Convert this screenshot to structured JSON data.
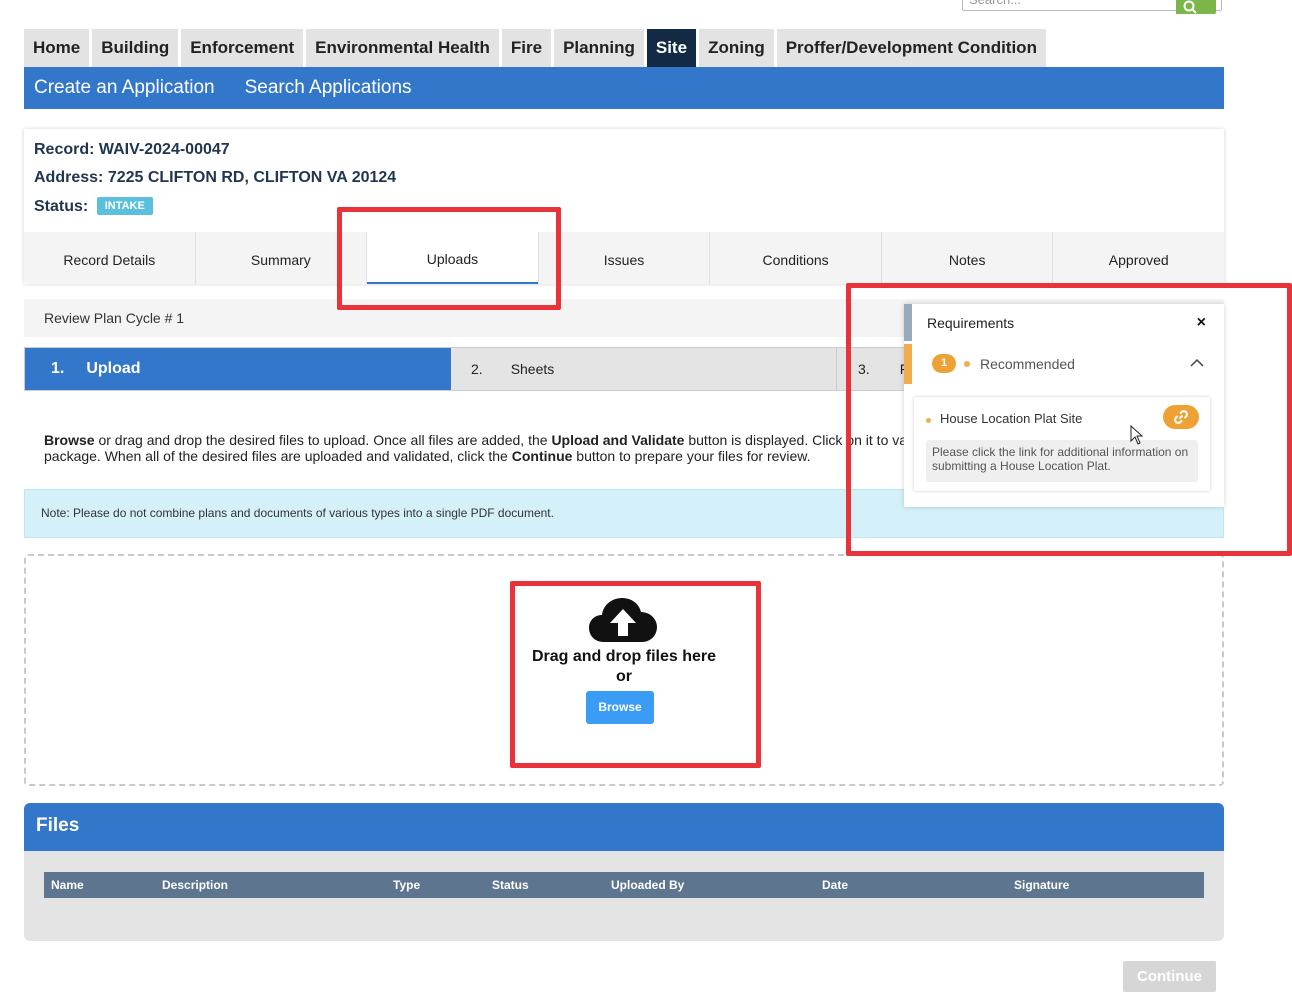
{
  "search": {
    "placeholder": "Search..."
  },
  "top_nav": {
    "tabs": [
      "Home",
      "Building",
      "Enforcement",
      "Environmental Health",
      "Fire",
      "Planning",
      "Site",
      "Zoning",
      "Proffer/Development Condition"
    ],
    "active": "Site"
  },
  "sub_nav": {
    "create": "Create an Application",
    "search": "Search Applications"
  },
  "record": {
    "record_label": "Record:",
    "record_id": "WAIV-2024-00047",
    "address_label": "Address:",
    "address": "7225 CLIFTON RD, CLIFTON VA 20124",
    "status_label": "Status:",
    "status": "INTAKE"
  },
  "record_tabs": [
    "Record Details",
    "Summary",
    "Uploads",
    "Issues",
    "Conditions",
    "Notes",
    "Approved"
  ],
  "review_cycle": "Review Plan Cycle # 1",
  "wizard": {
    "step1_num": "1.",
    "step1_label": "Upload",
    "step2_num": "2.",
    "step2_label": "Sheets",
    "step3_num": "3.",
    "step3_label": "F"
  },
  "instructions": {
    "browse": "Browse",
    "t1": " or drag and drop the desired files to upload. Once all files are added, the ",
    "upload_validate": "Upload and Validate",
    "t2": " button is displayed. Click on it to va",
    "t3": "package. When all of the desired files are uploaded and validated, click the ",
    "continue": "Continue",
    "t4": " button to prepare your files for review."
  },
  "note": "Note: Please do not combine plans and documents of various types into a single PDF document.",
  "dropzone": {
    "line1": "Drag and drop files here",
    "line2": "or",
    "browse_label": "Browse"
  },
  "files": {
    "title": "Files",
    "columns": [
      "Name",
      "Description",
      "Type",
      "Status",
      "Uploaded By",
      "Date",
      "Signature"
    ]
  },
  "continue_label": "Continue",
  "requirements": {
    "title": "Requirements",
    "close": "×",
    "recommended_count": "1",
    "recommended_label": "Recommended",
    "item_title": "House Location Plat Site",
    "item_desc": "Please click the link for additional information on submitting a House Location Plat."
  },
  "colors": {
    "primary": "#3277c9",
    "nav_active": "#132a44",
    "highlight": "#e8333a",
    "warning": "#eea236",
    "info_bg": "#d4f1f9"
  }
}
